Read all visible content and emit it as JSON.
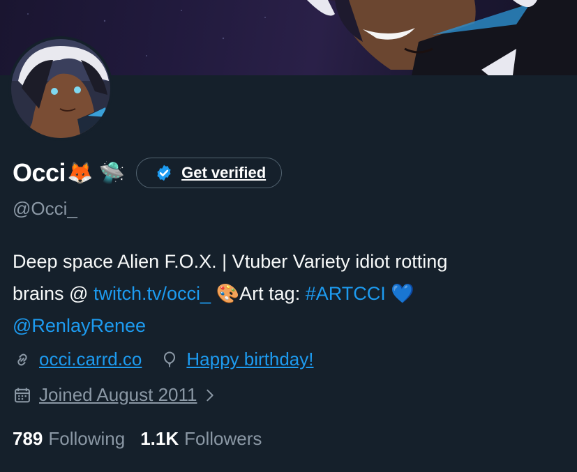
{
  "profile": {
    "display_name": "Occi",
    "name_emojis": "🦊 🛸",
    "verify_button_label": "Get verified",
    "handle": "@Occi_"
  },
  "bio": {
    "line1": "Deep space Alien F.O.X. | Vtuber Variety idiot rotting",
    "line2_prefix": "brains @ ",
    "twitch_link": "twitch.tv/occi_",
    "palette_emoji": "🎨",
    "art_tag_label": "Art tag: ",
    "hashtag": "#ARTCCI",
    "heart_emoji": "💙",
    "mention": "@RenlayRenee"
  },
  "meta": {
    "website": "occi.carrd.co",
    "birthday": "Happy birthday!",
    "joined": "Joined August 2011"
  },
  "stats": {
    "following_count": "789",
    "following_label": "Following",
    "followers_count": "1.1K",
    "followers_label": "Followers"
  },
  "colors": {
    "background": "#15202b",
    "accent": "#1d9bf0",
    "secondary_text": "#8b98a5"
  },
  "icons": [
    "verified-badge-icon",
    "link-icon",
    "balloon-icon",
    "calendar-icon",
    "chevron-right-icon"
  ]
}
